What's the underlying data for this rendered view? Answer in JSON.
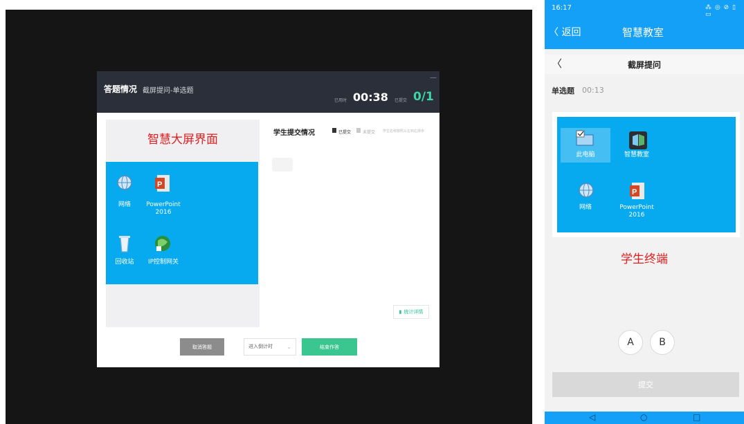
{
  "left": {
    "dialog": {
      "title": "答题情况",
      "subtitle": "截屏提问-单选题",
      "minimize": "—",
      "elapsed_label": "已用时",
      "elapsed_value": "00:38",
      "submitted_label": "已提交",
      "submitted_value": "0/1"
    },
    "screen_caption": "智慧大屏界面",
    "desktop_icons": [
      {
        "label": "网络",
        "icon": "network-icon"
      },
      {
        "label": "PowerPoint 2016",
        "icon": "powerpoint-icon"
      },
      {
        "label": "回收站",
        "icon": "recycle-bin-icon"
      },
      {
        "label": "IP控制网关",
        "icon": "ip-gateway-icon"
      }
    ],
    "submission": {
      "title": "学生提交情况",
      "legend_submitted": "已提交",
      "legend_unsubmitted": "未提交",
      "hint": "学生名称按照从左到右排序",
      "stats_button": "统计详情"
    },
    "footer": {
      "cancel": "取消答题",
      "countdown": "进入倒计时",
      "end": "结束作答"
    }
  },
  "phone": {
    "status_time": "16:17",
    "status_icons": "⁂ ◎ ⊘ ▯ ▭",
    "back": "〈 返回",
    "app_title": "智慧教室",
    "sub_back": "〈",
    "sub_title": "截屏提问",
    "question_type": "单选题",
    "question_time": "00:13",
    "desktop_icons": [
      {
        "label": "此电脑",
        "icon": "this-pc-icon"
      },
      {
        "label": "智慧教室",
        "icon": "smart-classroom-icon"
      },
      {
        "label": "网络",
        "icon": "network-icon"
      },
      {
        "label": "PowerPoint 2016",
        "icon": "powerpoint-icon"
      }
    ],
    "terminal_caption": "学生终端",
    "options": [
      "A",
      "B"
    ],
    "submit": "提交",
    "nav": [
      "◁",
      "○",
      "□"
    ]
  }
}
